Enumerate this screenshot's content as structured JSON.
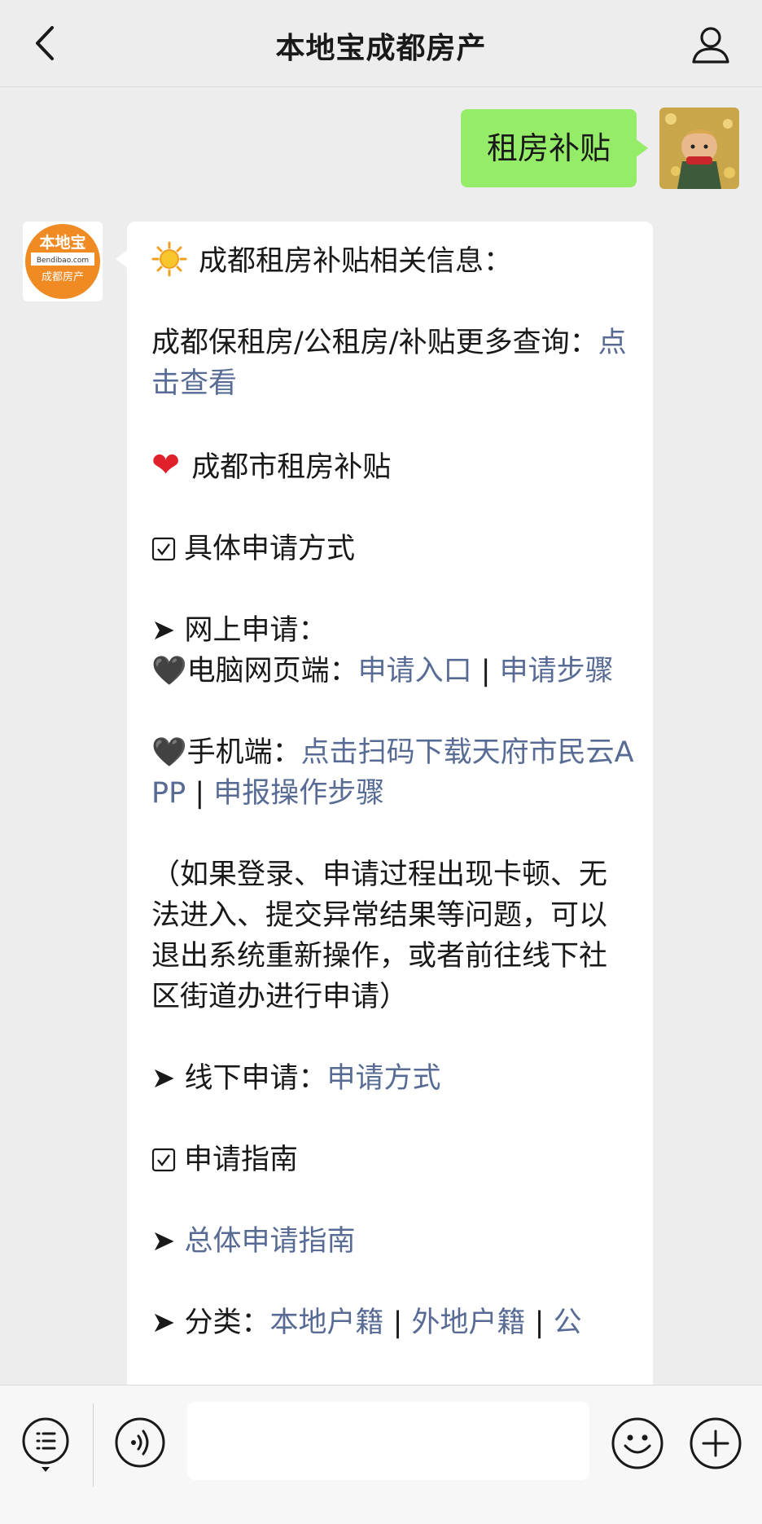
{
  "header": {
    "title": "本地宝成都房产",
    "back_icon": "chevron-left-icon",
    "profile_icon": "person-icon"
  },
  "outgoing": {
    "text": "租房补贴",
    "bubble_color": "#95ec69"
  },
  "incoming": {
    "avatar": {
      "brand": "本地宝",
      "site": "Bendibao.com",
      "sub": "成都房产",
      "color": "#f08a23"
    },
    "title": "成都租房补贴相关信息：",
    "line1_text": "成都保租房/公租房/补贴更多查询：",
    "line1_link": "点击查看",
    "section1": "成都市租房补贴",
    "sub1": "具体申请方式",
    "online_label": "➤ 网上申请：",
    "pc_label": "🖤电脑网页端：",
    "pc_link1": "申请入口",
    "sep": " | ",
    "pc_link2": "申请步骤",
    "mobile_label": "🖤手机端：",
    "mobile_link1": "点击扫码下载天府市民云APP",
    "mobile_link2": "申报操作步骤",
    "note": "（如果登录、申请过程出现卡顿、无法进入、提交异常结果等问题，可以退出系统重新操作，或者前往线下社区街道办进行申请）",
    "offline_label": "➤ 线下申请：",
    "offline_link": "申请方式",
    "sub2": "申请指南",
    "guide_prefix": "➤ ",
    "guide_link": "总体申请指南",
    "category_label": "➤ 分类：",
    "category_link1": "本地户籍",
    "category_link2": "外地户籍",
    "category_link3": "公",
    "link_color": "#576b95"
  },
  "bottom_bar": {
    "input_placeholder": "",
    "icons": [
      "menu-list-icon",
      "voice-icon",
      "emoji-icon",
      "plus-icon"
    ]
  }
}
